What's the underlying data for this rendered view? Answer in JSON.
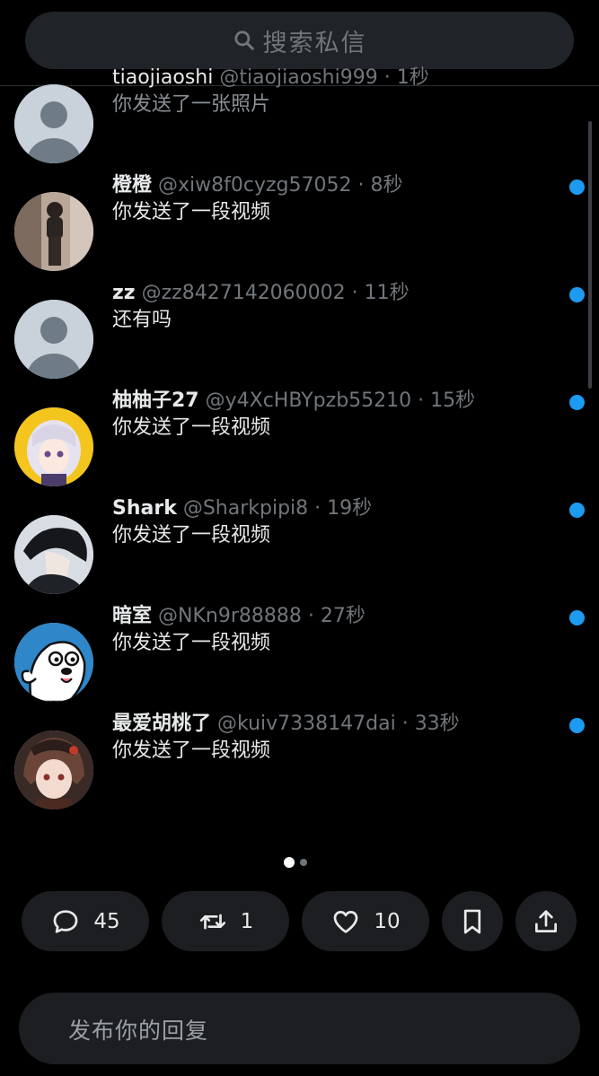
{
  "search": {
    "placeholder": "搜索私信"
  },
  "conversations": [
    {
      "name": "tiaojiaoshi",
      "handle": "@tiaojiaoshi999",
      "time": "· 1秒",
      "preview": "你发送了一张照片",
      "avatar": "default-avatar",
      "unread": false
    },
    {
      "name": "橙橙",
      "handle": "@xiw8f0cyzg57052",
      "time": "· 8秒",
      "preview": "你发送了一段视频",
      "avatar": "photo-avatar",
      "unread": true
    },
    {
      "name": "zz",
      "handle": "@zz8427142060002",
      "time": "· 11秒",
      "preview": "还有吗",
      "avatar": "default-avatar",
      "unread": true
    },
    {
      "name": "柚柚子27",
      "handle": "@y4XcHBYpzb55210",
      "time": "· 15秒",
      "preview": "你发送了一段视频",
      "avatar": "anime-girl-avatar",
      "unread": true
    },
    {
      "name": "Shark",
      "handle": "@Sharkpipi8",
      "time": "· 19秒",
      "preview": "你发送了一段视频",
      "avatar": "anime-boy-avatar",
      "unread": true
    },
    {
      "name": "暗室",
      "handle": "@NKn9r88888",
      "time": "· 27秒",
      "preview": "你发送了一段视频",
      "avatar": "cartoon-dog-avatar",
      "unread": true
    },
    {
      "name": "最爱胡桃了",
      "handle": "@kuiv7338147dai",
      "time": "· 33秒",
      "preview": "你发送了一段视频",
      "avatar": "anime-character-avatar",
      "unread": true
    }
  ],
  "pager": {
    "current": 1,
    "total": 2
  },
  "actions": {
    "reply_count": "45",
    "repost_count": "1",
    "like_count": "10"
  },
  "reply": {
    "placeholder": "发布你的回复"
  },
  "colors": {
    "accent": "#1d9bf0",
    "background": "#000000",
    "pill": "#1c1e21"
  }
}
